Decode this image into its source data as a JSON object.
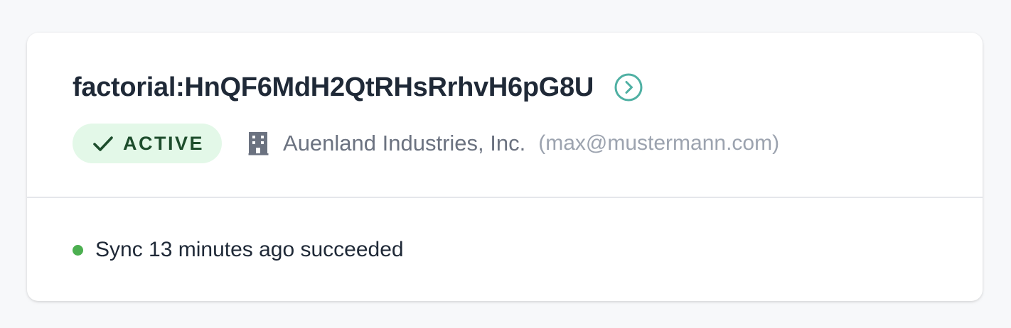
{
  "connection": {
    "title": "factorial:HnQF6MdH2QtRHsRrhvH6pG8U",
    "open_icon": "chevron-right-circle-icon",
    "status": {
      "label": "ACTIVE",
      "icon": "check-icon",
      "text_color": "#1d4d2c",
      "bg_color": "#e3f8e8"
    },
    "company": {
      "icon": "building-icon",
      "name": "Auenland Industries, Inc.",
      "email": "(max@mustermann.com)"
    },
    "sync": {
      "text": "Sync 13 minutes ago succeeded",
      "dot_color": "#4caf50"
    }
  },
  "colors": {
    "accent": "#4fb0a3",
    "page_background": "#f7f8fa",
    "card_background": "#ffffff"
  }
}
